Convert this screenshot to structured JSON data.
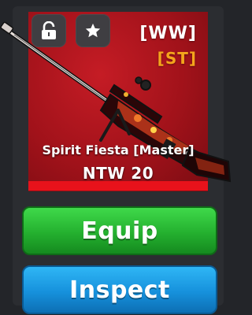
{
  "item": {
    "tag_primary": "[WW]",
    "tag_secondary": "[ST]",
    "skin_name": "Spirit Fiesta [Master]",
    "weapon_name": "NTW 20"
  },
  "actions": {
    "equip_label": "Equip",
    "inspect_label": "Inspect"
  },
  "icons": {
    "lock": "unlocked-padlock-icon",
    "favorite": "star-icon"
  },
  "colors": {
    "card_background": "#b1151d",
    "rarity_strip": "#e8121b",
    "tag_secondary": "#f4a51c",
    "equip_button": "#2cc336",
    "inspect_button": "#1a9be5"
  }
}
